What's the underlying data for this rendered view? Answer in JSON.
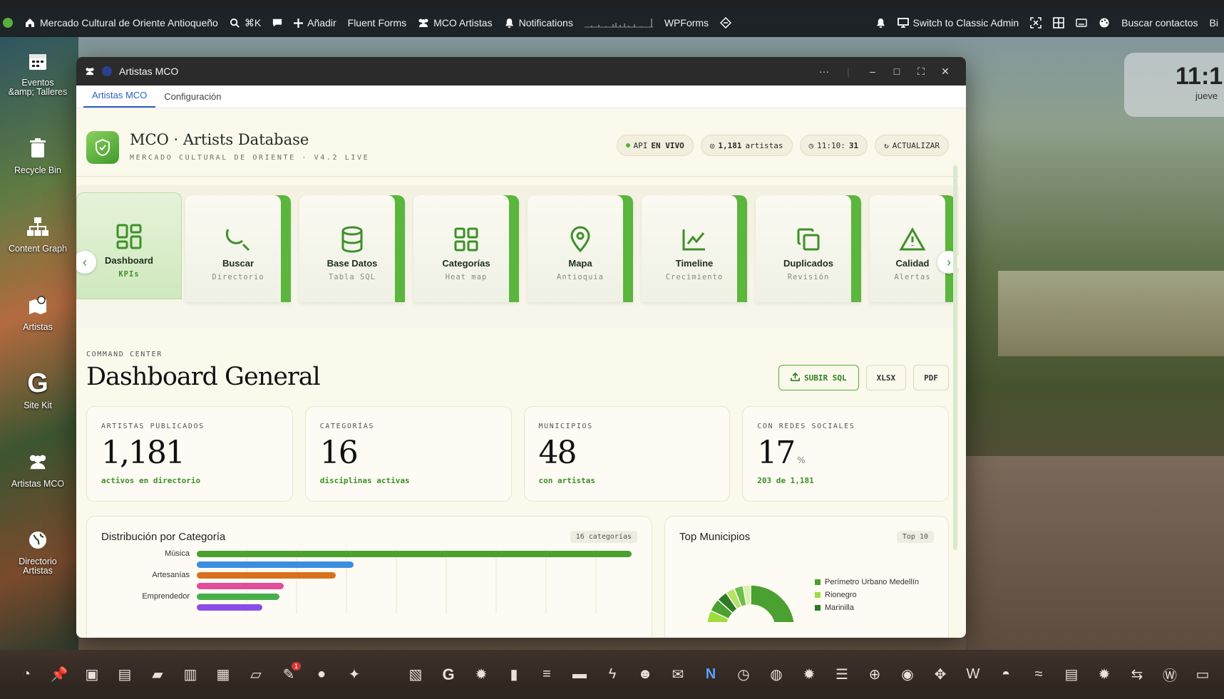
{
  "browser": {
    "url_fragment": "mercadoculturales/wp-admin/index.php?desktop_mode_portal=1&desktop_mode_portal_intent=1"
  },
  "adminbar": {
    "site": "Mercado Cultural de Oriente Antioqueño",
    "search_shortcut": "⌘K",
    "add": "Añadir",
    "fluent": "Fluent Forms",
    "mco": "MCO Artistas",
    "notifications": "Notifications",
    "wpforms": "WPForms",
    "classic": "Switch to Classic Admin",
    "contacts": "Buscar contactos",
    "trailing": "Bi"
  },
  "desktop": {
    "icons": [
      {
        "label": "Eventos\n&amp; Talleres",
        "icon": "calendar-icon"
      },
      {
        "label": "Recycle Bin",
        "icon": "trash-icon"
      },
      {
        "label": "Content Graph",
        "icon": "sitemap-icon"
      },
      {
        "label": "Artistas",
        "icon": "map-pin-icon"
      },
      {
        "label": "Site Kit",
        "icon": "google-icon"
      },
      {
        "label": "Artistas MCO",
        "icon": "users-icon"
      },
      {
        "label": "Directorio\nArtistas",
        "icon": "globe-icon"
      }
    ]
  },
  "clock": {
    "time": "11:1",
    "day": "jueve"
  },
  "window": {
    "title": "Artistas MCO",
    "tabs": [
      "Artistas MCO",
      "Configuración"
    ],
    "header": {
      "title": "MCO · Artists Database",
      "subtitle": "MERCADO CULTURAL DE ORIENTE · V4.2 LIVE",
      "pills": {
        "api_prefix": "API",
        "api": "EN VIVO",
        "count_num": "1,181",
        "count_label": "artistas",
        "time_prefix": "11:10:",
        "time_sec": "31",
        "refresh": "ACTUALIZAR"
      }
    },
    "nav_cards": [
      {
        "label": "Dashboard",
        "sub": "KPIs",
        "icon": "dashboard-grid-icon"
      },
      {
        "label": "Buscar",
        "sub": "Directorio",
        "icon": "search-icon"
      },
      {
        "label": "Base Datos",
        "sub": "Tabla SQL",
        "icon": "database-icon"
      },
      {
        "label": "Categorías",
        "sub": "Heat map",
        "icon": "grid-icon"
      },
      {
        "label": "Mapa",
        "sub": "Antioquia",
        "icon": "map-pin-icon"
      },
      {
        "label": "Timeline",
        "sub": "Crecimiento",
        "icon": "line-chart-icon"
      },
      {
        "label": "Duplicados",
        "sub": "Revisión",
        "icon": "copy-icon"
      },
      {
        "label": "Calidad",
        "sub": "Alertas",
        "icon": "alert-icon"
      }
    ],
    "section": {
      "kicker": "COMMAND CENTER",
      "title": "Dashboard General",
      "btn_upload": "SUBIR SQL",
      "btn_xlsx": "XLSX",
      "btn_pdf": "PDF"
    },
    "kpis": [
      {
        "label": "ARTISTAS PUBLICADOS",
        "value": "1,181",
        "unit": "",
        "note": "activos en directorio"
      },
      {
        "label": "CATEGORÍAS",
        "value": "16",
        "unit": "",
        "note": "disciplinas activas"
      },
      {
        "label": "MUNICIPIOS",
        "value": "48",
        "unit": "",
        "note": "con artistas"
      },
      {
        "label": "CON REDES SOCIALES",
        "value": "17",
        "unit": "%",
        "note": "203 de 1,181"
      }
    ],
    "category_panel": {
      "title": "Distribución por Categoría",
      "badge": "16 categorías"
    },
    "municipio_panel": {
      "title": "Top Municipios",
      "badge": "Top 10"
    }
  },
  "chart_data": [
    {
      "type": "bar",
      "title": "Distribución por Categoría",
      "categories": [
        "Música",
        "",
        "Artesanías",
        "",
        "Emprendedor",
        ""
      ],
      "values": [
        100,
        36,
        32,
        20,
        19,
        15
      ],
      "colors": [
        "#4aa030",
        "#3b8de0",
        "#d9701c",
        "#e24c9a",
        "#47b04a",
        "#8a4ee6"
      ]
    },
    {
      "type": "pie",
      "title": "Top Municipios",
      "legend": [
        "Perímetro Urbano Medellín",
        "Rionegro",
        "Marinilla"
      ],
      "legend_colors": [
        "#4aa030",
        "#9fdc3c",
        "#2e7a24"
      ]
    }
  ],
  "dock": [
    "dashboard",
    "pin",
    "media",
    "pages",
    "comments",
    "copy",
    "calendar",
    "map",
    "plugins",
    "users",
    "tools",
    "settings",
    "google",
    "gear",
    "chart",
    "layers",
    "forms",
    "bolt",
    "people",
    "mail",
    "nf",
    "clock",
    "globe",
    "gear2",
    "list",
    "plus",
    "ue",
    "move",
    "wp-w",
    "bell",
    "fw",
    "db",
    "gear3",
    "translate",
    "wordpress",
    "screen"
  ]
}
